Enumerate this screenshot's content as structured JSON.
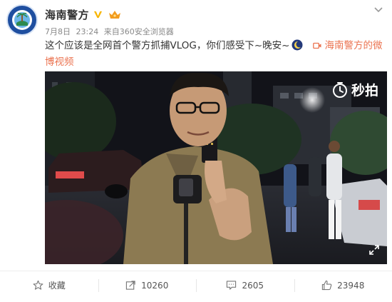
{
  "post": {
    "author": "海南警方",
    "meta": {
      "date": "7月8日",
      "time": "23:24",
      "source_prefix": "来自",
      "source": "360安全浏览器"
    },
    "text": "这个应该是全网首个警方抓捕VLOG，你们感受下~晚安~",
    "video_link": "海南警方的微博视频"
  },
  "video": {
    "watermark": "秒拍"
  },
  "actions": {
    "favorite_label": "收藏",
    "repost_count": "10260",
    "comment_count": "2605",
    "like_count": "23948"
  },
  "icons": {
    "verify": "verified-v-icon",
    "vip": "crown-icon",
    "moon": "moon-emoji-icon",
    "menu": "chevron-down-icon",
    "video_link": "video-camera-icon",
    "watermark": "miaopai-logo-icon",
    "fullscreen": "fullscreen-icon",
    "favorite": "star-icon",
    "repost": "repost-icon",
    "comment": "comment-icon",
    "like": "thumbs-up-icon"
  },
  "colors": {
    "link": "#eb7350",
    "verify": "#f7b500",
    "text": "#333333",
    "meta": "#888888"
  }
}
